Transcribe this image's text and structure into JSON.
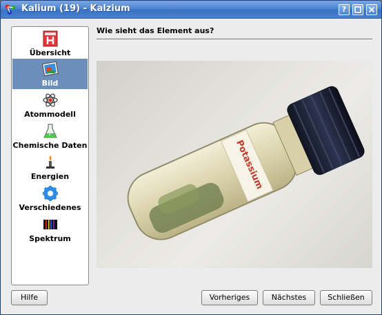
{
  "window": {
    "title": "Kalium (19) - Kalzium",
    "controls": {
      "help": "?",
      "maximize": "□",
      "close": "✕"
    }
  },
  "sidebar": {
    "items": [
      {
        "label": "Übersicht",
        "icon": "overview-icon",
        "selected": false
      },
      {
        "label": "Bild",
        "icon": "picture-icon",
        "selected": true
      },
      {
        "label": "Atommodell",
        "icon": "atom-model-icon",
        "selected": false
      },
      {
        "label": "Chemische Daten",
        "icon": "flask-icon",
        "selected": false
      },
      {
        "label": "Energien",
        "icon": "burner-icon",
        "selected": false
      },
      {
        "label": "Verschiedenes",
        "icon": "gear-icon",
        "selected": false
      },
      {
        "label": "Spektrum",
        "icon": "spectrum-icon",
        "selected": false
      }
    ]
  },
  "main": {
    "heading": "Wie sieht das Element aus?",
    "photo": {
      "label_text": "Potassium"
    }
  },
  "buttons": {
    "help": "Hilfe",
    "previous": "Vorheriges",
    "next": "Nächstes",
    "close": "Schließen"
  },
  "colors": {
    "titlebar": "#4f86d2",
    "selection": "#6b8fba",
    "background": "#ececec"
  }
}
